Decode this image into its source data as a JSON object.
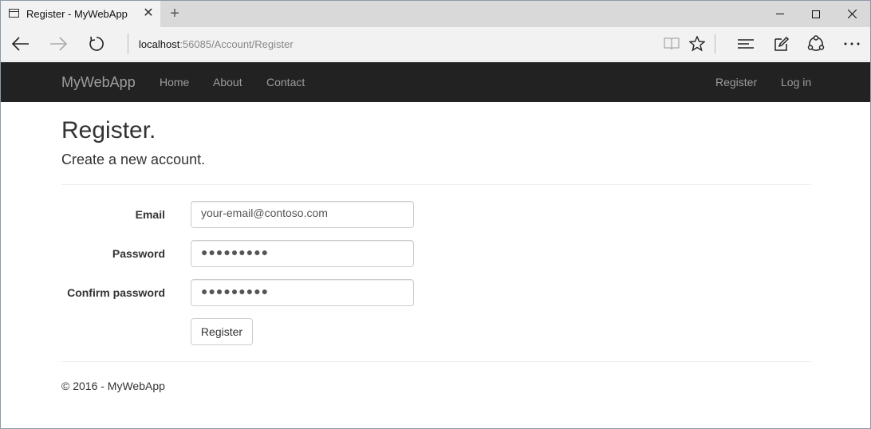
{
  "browser": {
    "tab_title": "Register - MyWebApp",
    "tab_close": "✕",
    "new_tab": "+",
    "url_host": "localhost",
    "url_path": ":56085/Account/Register"
  },
  "navbar": {
    "brand": "MyWebApp",
    "links": [
      "Home",
      "About",
      "Contact"
    ],
    "right_links": [
      "Register",
      "Log in"
    ]
  },
  "page": {
    "title": "Register.",
    "subtitle": "Create a new account."
  },
  "form": {
    "email_label": "Email",
    "email_value": "your-email@contoso.com",
    "password_label": "Password",
    "password_value": "●●●●●●●●●",
    "confirm_label": "Confirm password",
    "confirm_value": "●●●●●●●●●",
    "submit_label": "Register"
  },
  "footer": {
    "text": "© 2016 - MyWebApp"
  },
  "colors": {
    "navbar_bg": "#222222",
    "navbar_text": "#9d9d9d",
    "tab_active_bg": "#f2f2f2",
    "tabstrip_bg": "#d9d9d9"
  }
}
